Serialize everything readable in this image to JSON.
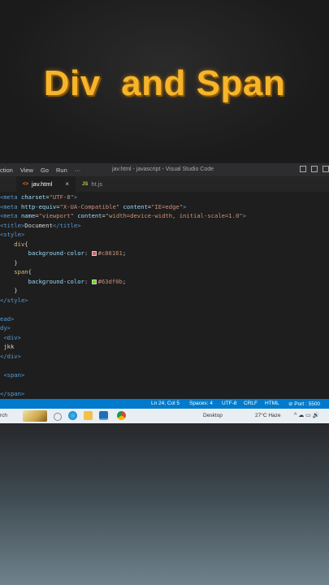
{
  "video_title": "Div  and Span",
  "menubar": {
    "items": [
      "ction",
      "View",
      "Go",
      "Run",
      "···"
    ],
    "window_title": "jav.html - javascript - Visual Studio Code"
  },
  "tabs": [
    {
      "icon": "<>",
      "label": "jav.html",
      "close": "×",
      "active": true
    },
    {
      "icon": "JS",
      "label": "ht.js",
      "active": false
    }
  ],
  "code_lines": [
    [
      {
        "c": "tag",
        "t": "<meta "
      },
      {
        "c": "attr",
        "t": "charset"
      },
      {
        "c": "txt",
        "t": "="
      },
      {
        "c": "str",
        "t": "\"UTF-8\""
      },
      {
        "c": "tag",
        "t": ">"
      }
    ],
    [
      {
        "c": "tag",
        "t": "<meta "
      },
      {
        "c": "attr",
        "t": "http-equiv"
      },
      {
        "c": "txt",
        "t": "="
      },
      {
        "c": "str",
        "t": "\"X-UA-Compatible\""
      },
      {
        "c": "attr",
        "t": " content"
      },
      {
        "c": "txt",
        "t": "="
      },
      {
        "c": "str",
        "t": "\"IE=edge\""
      },
      {
        "c": "tag",
        "t": ">"
      }
    ],
    [
      {
        "c": "tag",
        "t": "<meta "
      },
      {
        "c": "attr",
        "t": "name"
      },
      {
        "c": "txt",
        "t": "="
      },
      {
        "c": "str",
        "t": "\"viewport\""
      },
      {
        "c": "attr",
        "t": " content"
      },
      {
        "c": "txt",
        "t": "="
      },
      {
        "c": "str",
        "t": "\"width=device-width, initial-scale=1.0\""
      },
      {
        "c": "tag",
        "t": ">"
      }
    ],
    [
      {
        "c": "tag",
        "t": "<title>"
      },
      {
        "c": "txt",
        "t": "Document"
      },
      {
        "c": "tag",
        "t": "</title>"
      }
    ],
    [
      {
        "c": "tag",
        "t": "<style>"
      }
    ],
    [
      {
        "c": "sel",
        "t": "    div"
      },
      {
        "c": "txt",
        "t": "{"
      }
    ],
    [
      {
        "c": "prop",
        "t": "        background-color"
      },
      {
        "c": "txt",
        "t": ": "
      },
      {
        "c": "swatch",
        "t": "#c86161"
      },
      {
        "c": "str",
        "t": "#c86161"
      },
      {
        "c": "txt",
        "t": ";"
      }
    ],
    [
      {
        "c": "txt",
        "t": "    }"
      }
    ],
    [
      {
        "c": "sel",
        "t": "    span"
      },
      {
        "c": "txt",
        "t": "{"
      }
    ],
    [
      {
        "c": "prop",
        "t": "        background-color"
      },
      {
        "c": "txt",
        "t": ": "
      },
      {
        "c": "swatch",
        "t": "#63df0b"
      },
      {
        "c": "str",
        "t": "#63df0b"
      },
      {
        "c": "txt",
        "t": ";"
      }
    ],
    [
      {
        "c": "txt",
        "t": "    }"
      }
    ],
    [
      {
        "c": "tag",
        "t": "</style>"
      }
    ],
    [],
    [
      {
        "c": "tag",
        "t": "ead>"
      }
    ],
    [
      {
        "c": "tag",
        "t": "dy>"
      }
    ],
    [
      {
        "c": "tag",
        "t": " <div>"
      }
    ],
    [
      {
        "c": "txt",
        "t": " jkk"
      }
    ],
    [
      {
        "c": "tag",
        "t": "</div>"
      }
    ],
    [],
    [
      {
        "c": "tag",
        "t": " <span>"
      }
    ],
    [],
    [
      {
        "c": "tag",
        "t": "</span>"
      }
    ]
  ],
  "statusbar": {
    "position": "Ln 24, Col 5",
    "spaces": "Spaces: 4",
    "encoding": "UTF-8",
    "eol": "CRLF",
    "language": "HTML",
    "port": "⊘ Port : 5500"
  },
  "taskbar": {
    "search": "rch",
    "desktop": "Desktop",
    "weather": "27°C Haze",
    "tray": "^ ☁ ▭ 🔊"
  }
}
